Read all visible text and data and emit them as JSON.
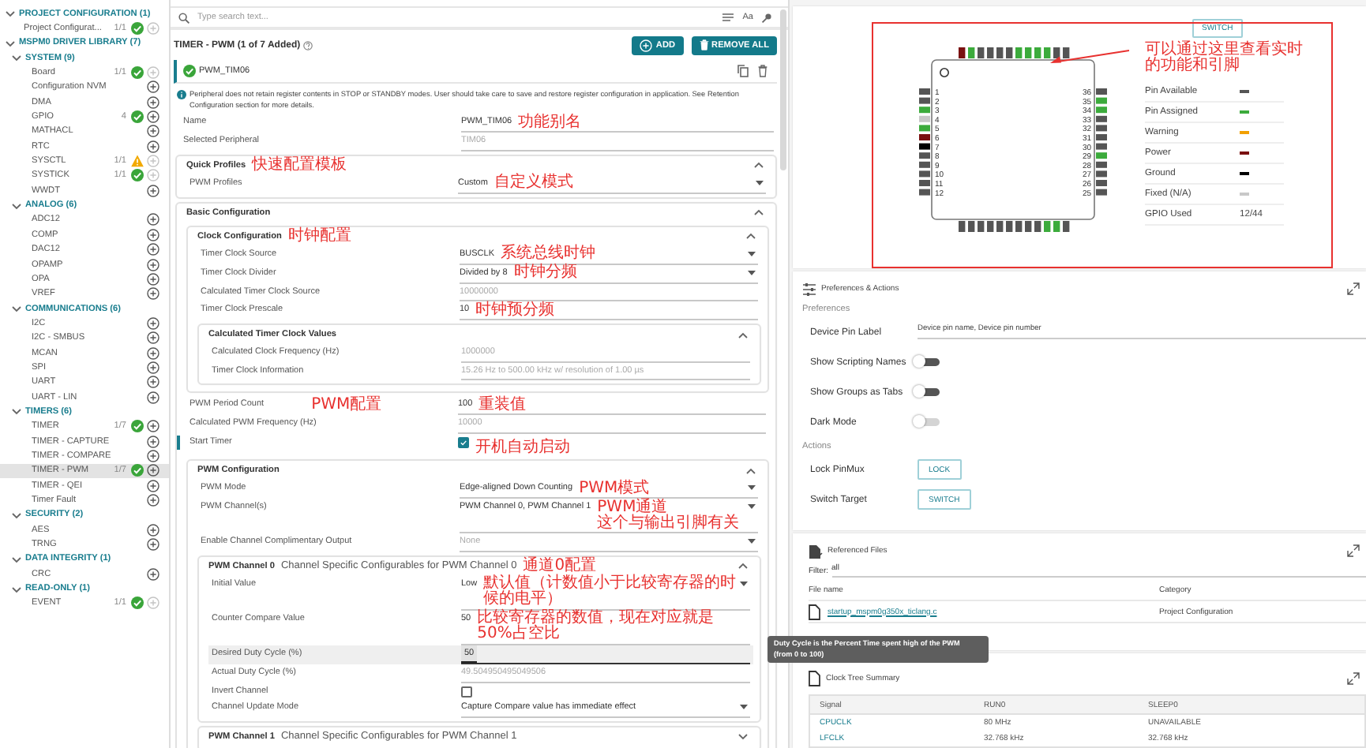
{
  "sidebar": {
    "tree": [
      {
        "label": "PROJECT CONFIGURATION (1)",
        "expanded": true,
        "children": [
          {
            "label": "Project Configurat...",
            "count": "1/1",
            "warning": false,
            "add_disabled": true,
            "selected": false
          }
        ]
      },
      {
        "label": "MSPM0 DRIVER LIBRARY (7)",
        "expanded": true,
        "children": [
          {
            "label": "SYSTEM (9)",
            "expanded": true,
            "children": [
              {
                "label": "Board",
                "count": "1/1",
                "warning": false,
                "add_disabled": true,
                "selected": false
              },
              {
                "label": "Configuration NVM",
                "add_disabled": false,
                "selected": false
              },
              {
                "label": "DMA",
                "add_disabled": false,
                "selected": false
              },
              {
                "label": "GPIO",
                "count": "4",
                "warning": false,
                "add_disabled": false,
                "selected": false
              },
              {
                "label": "MATHACL",
                "add_disabled": false,
                "selected": false
              },
              {
                "label": "RTC",
                "add_disabled": false,
                "selected": false
              },
              {
                "label": "SYSCTL",
                "count": "1/1",
                "warning": true,
                "add_disabled": true,
                "selected": false
              },
              {
                "label": "SYSTICK",
                "count": "1/1",
                "warning": false,
                "add_disabled": true,
                "selected": false
              },
              {
                "label": "WWDT",
                "add_disabled": false,
                "selected": false
              }
            ]
          },
          {
            "label": "ANALOG (6)",
            "expanded": true,
            "children": [
              {
                "label": "ADC12",
                "add_disabled": false,
                "selected": false
              },
              {
                "label": "COMP",
                "add_disabled": false,
                "selected": false
              },
              {
                "label": "DAC12",
                "add_disabled": false,
                "selected": false
              },
              {
                "label": "OPAMP",
                "add_disabled": false,
                "selected": false
              },
              {
                "label": "OPA",
                "add_disabled": false,
                "selected": false
              },
              {
                "label": "VREF",
                "add_disabled": false,
                "selected": false
              }
            ]
          },
          {
            "label": "COMMUNICATIONS (6)",
            "expanded": true,
            "children": [
              {
                "label": "I2C",
                "add_disabled": false,
                "selected": false
              },
              {
                "label": "I2C - SMBUS",
                "add_disabled": false,
                "selected": false
              },
              {
                "label": "MCAN",
                "add_disabled": false,
                "selected": false
              },
              {
                "label": "SPI",
                "add_disabled": false,
                "selected": false
              },
              {
                "label": "UART",
                "add_disabled": false,
                "selected": false
              },
              {
                "label": "UART - LIN",
                "add_disabled": false,
                "selected": false
              }
            ]
          },
          {
            "label": "TIMERS (6)",
            "expanded": true,
            "children": [
              {
                "label": "TIMER",
                "count": "1/7",
                "warning": false,
                "add_disabled": false,
                "selected": false
              },
              {
                "label": "TIMER - CAPTURE",
                "add_disabled": false,
                "selected": false
              },
              {
                "label": "TIMER - COMPARE",
                "add_disabled": false,
                "selected": false
              },
              {
                "label": "TIMER - PWM",
                "count": "1/7",
                "warning": false,
                "add_disabled": false,
                "selected": true
              },
              {
                "label": "TIMER - QEI",
                "add_disabled": false,
                "selected": false
              },
              {
                "label": "Timer Fault",
                "add_disabled": false,
                "selected": false
              }
            ]
          },
          {
            "label": "SECURITY (2)",
            "expanded": true,
            "children": [
              {
                "label": "AES",
                "add_disabled": false,
                "selected": false
              },
              {
                "label": "TRNG",
                "add_disabled": false,
                "selected": false
              }
            ]
          },
          {
            "label": "DATA INTEGRITY (1)",
            "expanded": true,
            "children": [
              {
                "label": "CRC",
                "add_disabled": false,
                "selected": false
              }
            ]
          },
          {
            "label": "READ-ONLY (1)",
            "expanded": true,
            "children": [
              {
                "label": "EVENT",
                "count": "1/1",
                "warning": false,
                "add_disabled": true,
                "selected": false
              }
            ]
          }
        ]
      }
    ]
  },
  "module": {
    "search": {
      "placeholder": "Type search text..."
    },
    "font_button": "Aa",
    "title": "TIMER - PWM (1 of 7 Added)",
    "add_button": "ADD",
    "remove_button": "REMOVE ALL",
    "instance": {
      "name": "PWM_TIM06",
      "selected": true
    },
    "notice": "Peripheral does not retain register contents in STOP or STANDBY modes. User should take care to save and restore register configuration in application. See Retention Configuration section for more details.",
    "items": [
      {
        "kind": "text",
        "label": "Name",
        "value": "PWM_TIM06",
        "note": "功能别名"
      },
      {
        "kind": "readonly",
        "label": "Selected Peripheral",
        "value": "TIM06"
      },
      {
        "kind": "card",
        "title": "Quick Profiles",
        "note": "快速配置模板",
        "expanded": true,
        "items": [
          {
            "kind": "select",
            "label": "PWM Profiles",
            "value": "Custom",
            "note": "自定义模式"
          }
        ]
      },
      {
        "kind": "card",
        "title": "Basic Configuration",
        "expanded": true,
        "items": [
          {
            "kind": "card",
            "title": "Clock Configuration",
            "note": "时钟配置",
            "expanded": true,
            "items": [
              {
                "kind": "select",
                "label": "Timer Clock Source",
                "value": "BUSCLK",
                "note": "系统总线时钟"
              },
              {
                "kind": "select",
                "label": "Timer Clock Divider",
                "value": "Divided by 8",
                "note": "时钟分频"
              },
              {
                "kind": "readonly",
                "label": "Calculated Timer Clock Source",
                "value": "10000000"
              },
              {
                "kind": "text",
                "label": "Timer Clock Prescale",
                "value": "10",
                "note": "时钟预分频"
              },
              {
                "kind": "card",
                "title": "Calculated Timer Clock Values",
                "expanded": true,
                "items": [
                  {
                    "kind": "readonly",
                    "label": "Calculated Clock Frequency (Hz)",
                    "value": "1000000"
                  },
                  {
                    "kind": "readonly",
                    "label": "Timer Clock Information",
                    "value": "15.26 Hz to 500.00 kHz w/ resolution of 1.00 µs"
                  }
                ]
              }
            ]
          },
          {
            "kind": "text",
            "label": "PWM Period Count",
            "value": "100",
            "label_note": "PWM配置",
            "note": "重装值",
            "modified": false
          },
          {
            "kind": "readonly",
            "label": "Calculated PWM Frequency (Hz)",
            "value": "10000",
            "modified": false
          },
          {
            "kind": "checkbox",
            "label": "Start Timer",
            "checked": true,
            "note": "开机自动启动",
            "modified": true
          },
          {
            "kind": "card",
            "title": "PWM Configuration",
            "expanded": true,
            "items": [
              {
                "kind": "select",
                "label": "PWM Mode",
                "value": "Edge-aligned Down Counting",
                "note": "PWM模式"
              },
              {
                "kind": "select",
                "label": "PWM Channel(s)",
                "value": "PWM Channel 0, PWM Channel 1",
                "note": [
                  "PWM通道",
                  "这个与输出引脚有关"
                ]
              },
              {
                "kind": "disabled_select",
                "label": "Enable Channel Complimentary Output",
                "value": "None"
              },
              {
                "kind": "card",
                "title": "PWM Channel 0",
                "subtitle": "Channel Specific Configurables for PWM Channel 0",
                "note": "通道0配置",
                "expanded": true,
                "items": [
                  {
                    "kind": "select",
                    "label": "Initial Value",
                    "value": "Low",
                    "note": "默认值（计数值小于比较寄存器的时候的电平）",
                    "focused": false
                  },
                  {
                    "kind": "text",
                    "label": "Counter Compare Value",
                    "value": "50",
                    "note": "比较寄存器的数值，现在对应就是50%占空比",
                    "focused": false
                  },
                  {
                    "kind": "text",
                    "label": "Desired Duty Cycle (%)",
                    "value": "50",
                    "focused": true
                  },
                  {
                    "kind": "readonly",
                    "label": "Actual Duty Cycle (%)",
                    "value": "49.504950495049506",
                    "focused": false
                  },
                  {
                    "kind": "checkbox",
                    "label": "Invert Channel",
                    "checked": false,
                    "focused": false
                  },
                  {
                    "kind": "select",
                    "label": "Channel Update Mode",
                    "value": "Capture Compare value has immediate effect",
                    "focused": false
                  }
                ]
              },
              {
                "kind": "card",
                "title": "PWM Channel 1",
                "subtitle": "Channel Specific Configurables for PWM Channel 1",
                "expanded": false
              }
            ]
          }
        ]
      }
    ]
  },
  "pinout": {
    "switch_button": "SWITCH",
    "note": [
      "可以通过这里查看实时",
      "的功能和引脚"
    ],
    "top_pins": [
      {
        "color": "#7a1010"
      },
      {
        "color": "#3cab3c"
      },
      {
        "color": "#555555"
      },
      {
        "color": "#555555"
      },
      {
        "color": "#555555"
      },
      {
        "color": "#555555"
      },
      {
        "color": "#3cab3c"
      },
      {
        "color": "#3cab3c"
      },
      {
        "color": "#3cab3c"
      },
      {
        "color": "#3cab3c"
      },
      {
        "color": "#555555"
      },
      {
        "color": "#555555"
      }
    ],
    "left_pins": [
      {
        "number": "1",
        "color": "#555555"
      },
      {
        "number": "2",
        "color": "#555555"
      },
      {
        "number": "3",
        "color": "#3cab3c"
      },
      {
        "number": "4",
        "color": "#c8c8c8"
      },
      {
        "number": "5",
        "color": "#3cab3c"
      },
      {
        "number": "6",
        "color": "#7a1010"
      },
      {
        "number": "7",
        "color": "#000000"
      },
      {
        "number": "8",
        "color": "#555555"
      },
      {
        "number": "9",
        "color": "#555555"
      },
      {
        "number": "10",
        "color": "#555555"
      },
      {
        "number": "11",
        "color": "#555555"
      },
      {
        "number": "12",
        "color": "#555555"
      }
    ],
    "right_pins": [
      {
        "number": "36",
        "color": "#555555"
      },
      {
        "number": "35",
        "color": "#3cab3c"
      },
      {
        "number": "34",
        "color": "#3cab3c"
      },
      {
        "number": "33",
        "color": "#555555"
      },
      {
        "number": "32",
        "color": "#555555"
      },
      {
        "number": "31",
        "color": "#555555"
      },
      {
        "number": "30",
        "color": "#555555"
      },
      {
        "number": "29",
        "color": "#3cab3c"
      },
      {
        "number": "28",
        "color": "#555555"
      },
      {
        "number": "27",
        "color": "#555555"
      },
      {
        "number": "26",
        "color": "#555555"
      },
      {
        "number": "25",
        "color": "#555555"
      }
    ],
    "bottom_pins": [
      {
        "color": "#555555"
      },
      {
        "color": "#555555"
      },
      {
        "color": "#555555"
      },
      {
        "color": "#555555"
      },
      {
        "color": "#555555"
      },
      {
        "color": "#555555"
      },
      {
        "color": "#555555"
      },
      {
        "color": "#555555"
      },
      {
        "color": "#555555"
      },
      {
        "color": "#3cab3c"
      },
      {
        "color": "#3cab3c"
      },
      {
        "color": "#555555"
      }
    ],
    "legend": [
      {
        "label": "Pin Available",
        "color": "#555555"
      },
      {
        "label": "Pin Assigned",
        "color": "#3cab3c"
      },
      {
        "label": "Warning",
        "color": "#f2a000"
      },
      {
        "label": "Power",
        "color": "#7a1010"
      },
      {
        "label": "Ground",
        "color": "#000000"
      },
      {
        "label": "Fixed (N/A)",
        "color": "#c8c8c8"
      }
    ],
    "gpio_used": {
      "label": "GPIO Used",
      "value": "12/44"
    }
  },
  "preferences": {
    "title": "Preferences & Actions",
    "sections": [
      {
        "title": "Preferences",
        "items": [
          {
            "kind": "field",
            "label": "Device Pin Label",
            "value": "Device pin name, Device pin number"
          },
          {
            "kind": "toggle",
            "label": "Show Scripting Names",
            "on": false,
            "disabled": false
          },
          {
            "kind": "toggle",
            "label": "Show Groups as Tabs",
            "on": false,
            "disabled": false
          },
          {
            "kind": "toggle",
            "label": "Dark Mode",
            "on": false,
            "disabled": true
          }
        ]
      },
      {
        "title": "Actions",
        "items": [
          {
            "kind": "button",
            "label": "Lock PinMux",
            "button": "LOCK"
          },
          {
            "kind": "button",
            "label": "Switch Target",
            "button": "SWITCH"
          }
        ]
      }
    ]
  },
  "referenced_files": {
    "title": "Referenced Files",
    "filter_label": "Filter:",
    "filter": "all",
    "columns": [
      "File name",
      "Category"
    ],
    "rows": [
      {
        "file": "startup_mspm0g350x_ticlang.c",
        "category": "Project Configuration"
      }
    ]
  },
  "clock_tree": {
    "title": "Clock Tree Summary",
    "columns": [
      "Signal",
      "RUN0",
      "SLEEP0"
    ],
    "rows": [
      [
        "CPUCLK",
        "80 MHz",
        "UNAVAILABLE"
      ],
      [
        "LFCLK",
        "32.768 kHz",
        "32.768 kHz"
      ]
    ]
  },
  "tooltip": [
    "Duty Cycle is the Percent Time spent high of the PWM",
    "(from 0 to 100)"
  ]
}
